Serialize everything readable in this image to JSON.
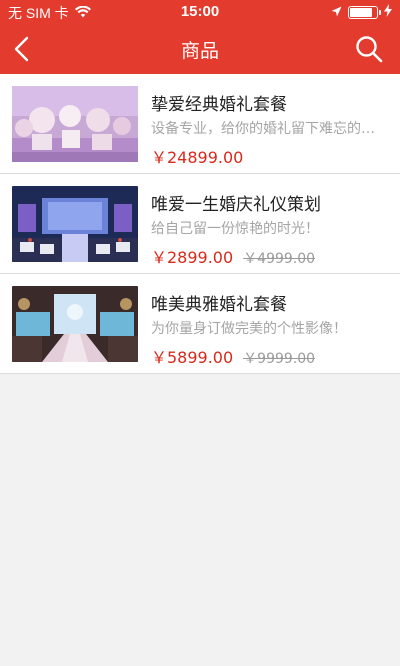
{
  "status_bar": {
    "carrier": "无 SIM 卡",
    "time": "15:00",
    "battery_level": 0.85,
    "icons": [
      "wifi-icon",
      "location-arrow-icon",
      "battery-icon",
      "charging-bolt-icon"
    ]
  },
  "nav": {
    "title": "商品",
    "back_icon": "chevron-left-icon",
    "search_icon": "search-icon"
  },
  "colors": {
    "accent": "#e33b2e",
    "price": "#d9291c",
    "muted_text": "#a5a5a5",
    "background": "#f2f2f2"
  },
  "products": [
    {
      "title": "挚爱经典婚礼套餐",
      "description": "设备专业，给你的婚礼留下难忘的回忆",
      "price": "￥24899.00",
      "original_price": "",
      "image": "wedding-venue-photo"
    },
    {
      "title": "唯爱一生婚庆礼仪策划",
      "description": "给自己留一份惊艳的时光！",
      "price": "￥2899.00",
      "original_price": "￥4999.00",
      "image": "wedding-stage-photo"
    },
    {
      "title": "唯美典雅婚礼套餐",
      "description": "为你量身订做完美的个性影像！",
      "price": "￥5899.00",
      "original_price": "￥9999.00",
      "image": "wedding-aisle-photo"
    }
  ]
}
